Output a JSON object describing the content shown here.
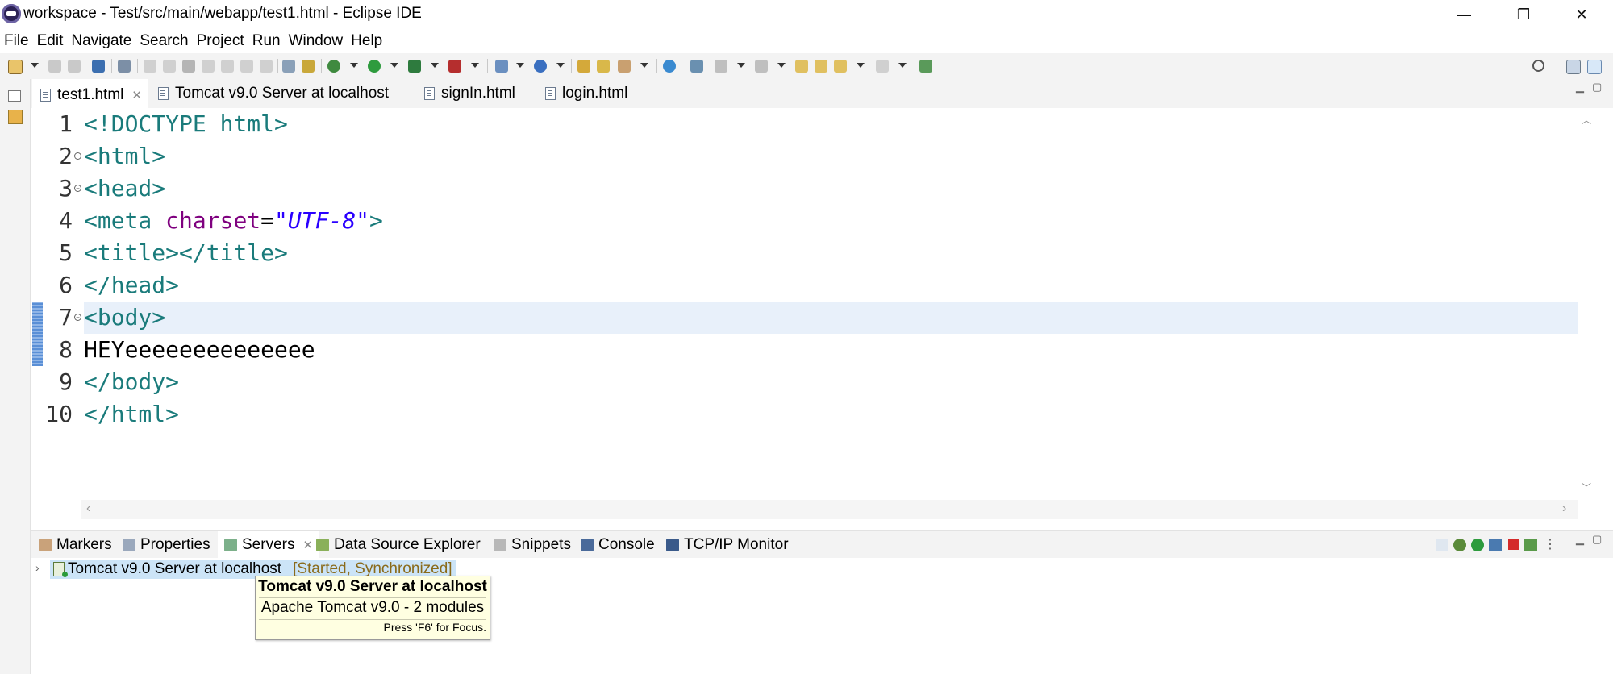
{
  "window": {
    "title": "workspace - Test/src/main/webapp/test1.html - Eclipse IDE",
    "controls": {
      "minimize": "—",
      "restore": "❐",
      "close": "✕"
    }
  },
  "menu": [
    "File",
    "Edit",
    "Navigate",
    "Search",
    "Project",
    "Run",
    "Window",
    "Help"
  ],
  "editor_tabs": [
    {
      "label": "test1.html",
      "active": true,
      "closable": true
    },
    {
      "label": "Tomcat v9.0 Server at localhost",
      "active": false
    },
    {
      "label": "signIn.html",
      "active": false
    },
    {
      "label": "login.html",
      "active": false
    }
  ],
  "editor": {
    "current_line": 7,
    "lines": [
      {
        "num": "1",
        "segments": [
          {
            "cls": "",
            "text": "<!DOCTYPE html>"
          }
        ]
      },
      {
        "num": "2",
        "fold": true,
        "segments": [
          {
            "cls": "",
            "text": "<html>"
          }
        ]
      },
      {
        "num": "3",
        "fold": true,
        "segments": [
          {
            "cls": "",
            "text": "<head>"
          }
        ]
      },
      {
        "num": "4",
        "segments": [
          {
            "cls": "",
            "text": "<meta "
          },
          {
            "cls": "attr",
            "text": "charset"
          },
          {
            "cls": "txt",
            "text": "="
          },
          {
            "cls": "val",
            "text": "\"UTF-8\""
          },
          {
            "cls": "",
            "text": ">"
          }
        ]
      },
      {
        "num": "5",
        "segments": [
          {
            "cls": "",
            "text": "<title></title>"
          }
        ]
      },
      {
        "num": "6",
        "segments": [
          {
            "cls": "",
            "text": "</head>"
          }
        ]
      },
      {
        "num": "7",
        "fold": true,
        "segments": [
          {
            "cls": "",
            "text": "<body>"
          }
        ]
      },
      {
        "num": "8",
        "segments": [
          {
            "cls": "txt",
            "text": "HEYeeeeeeeeeeeeee"
          }
        ]
      },
      {
        "num": "9",
        "segments": [
          {
            "cls": "",
            "text": "</body>"
          }
        ]
      },
      {
        "num": "10",
        "segments": [
          {
            "cls": "",
            "text": "</html>"
          }
        ]
      }
    ]
  },
  "panel_tabs": [
    {
      "label": "Markers",
      "icon": "markers-icon",
      "color": "#8a5a2a"
    },
    {
      "label": "Properties",
      "icon": "properties-icon",
      "color": "#5a6a8a"
    },
    {
      "label": "Servers",
      "icon": "servers-icon",
      "color": "#3a7a4a",
      "active": true,
      "closable": true
    },
    {
      "label": "Data Source Explorer",
      "icon": "data-source-icon",
      "color": "#4a8a2a"
    },
    {
      "label": "Snippets",
      "icon": "snippets-icon",
      "color": "#6a6a6a"
    },
    {
      "label": "Console",
      "icon": "console-icon",
      "color": "#2a4a7a"
    },
    {
      "label": "TCP/IP Monitor",
      "icon": "tcpip-monitor-icon",
      "color": "#2a4a7a"
    }
  ],
  "servers": {
    "name": "Tomcat v9.0 Server at localhost",
    "status": "[Started, Synchronized]"
  },
  "tooltip": {
    "title": "Tomcat v9.0 Server at localhost",
    "detail": "Apache Tomcat v9.0 - 2 modules",
    "hint": "Press 'F6' for Focus."
  },
  "colors": {
    "tag": "#1a7b7b",
    "attribute": "#7f007f",
    "string": "#2a00ff",
    "current_line": "#e8f0fa",
    "selection": "#cce4f7",
    "tooltip_bg": "#ffffe1"
  }
}
